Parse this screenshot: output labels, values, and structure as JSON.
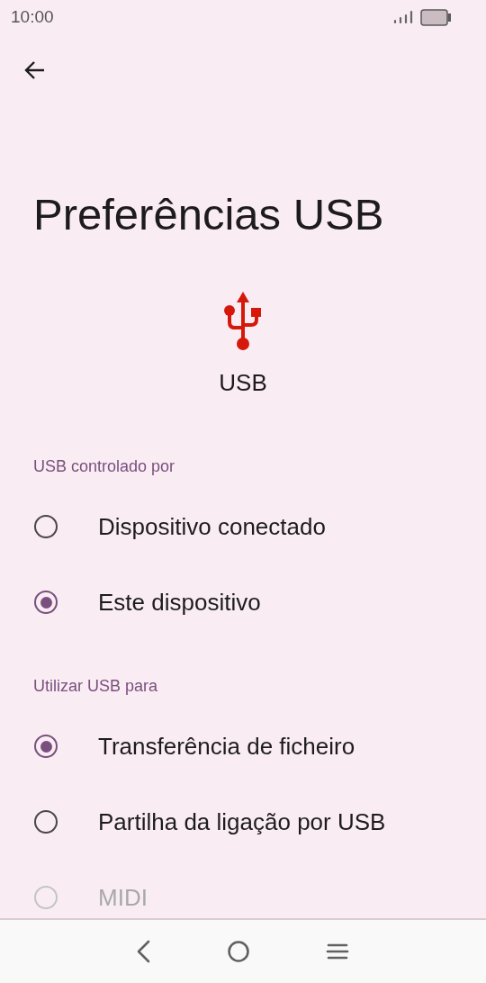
{
  "status_bar": {
    "time": "10:00"
  },
  "title": "Preferências USB",
  "usb_label": "USB",
  "sections": [
    {
      "header": "USB controlado por",
      "options": [
        {
          "label": "Dispositivo conectado",
          "selected": false
        },
        {
          "label": "Este dispositivo",
          "selected": true
        }
      ]
    },
    {
      "header": "Utilizar USB para",
      "options": [
        {
          "label": "Transferência de ficheiro",
          "selected": true
        },
        {
          "label": "Partilha da ligação por USB",
          "selected": false
        },
        {
          "label": "MIDI",
          "selected": false
        }
      ]
    }
  ]
}
